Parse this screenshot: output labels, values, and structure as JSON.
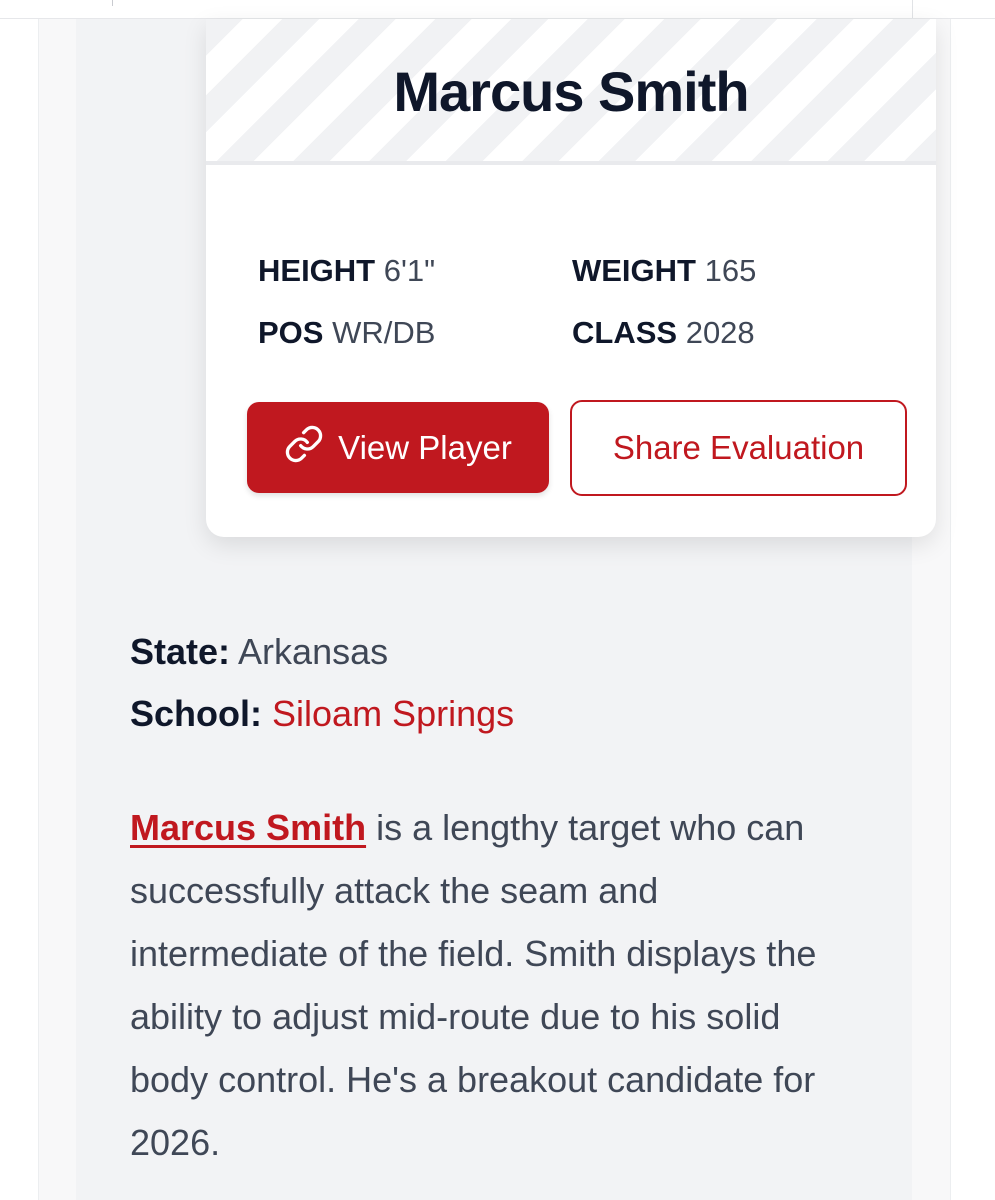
{
  "player": {
    "name": "Marcus Smith"
  },
  "stats": {
    "height_label": "HEIGHT",
    "height_value": "6'1\"",
    "weight_label": "WEIGHT",
    "weight_value": "165",
    "pos_label": "POS",
    "pos_value": "WR/DB",
    "class_label": "CLASS",
    "class_value": "2028"
  },
  "actions": {
    "view_player_label": "View Player",
    "view_player_icon": "link-icon",
    "share_label": "Share Evaluation"
  },
  "info": {
    "state_label": "State:",
    "state_value": "Arkansas",
    "school_label": "School:",
    "school_value": "Siloam Springs"
  },
  "bio": {
    "name_link": "Marcus Smith",
    "text": " is a lengthy target who can successfully attack the seam and intermediate of the field. Smith displays the ability to adjust mid-route due to his solid body control. He's a breakout candidate for 2026."
  },
  "colors": {
    "accent": "#c0181f",
    "heading": "#0f172a",
    "body_text": "#3f4756",
    "page_bg": "#f2f3f5"
  }
}
